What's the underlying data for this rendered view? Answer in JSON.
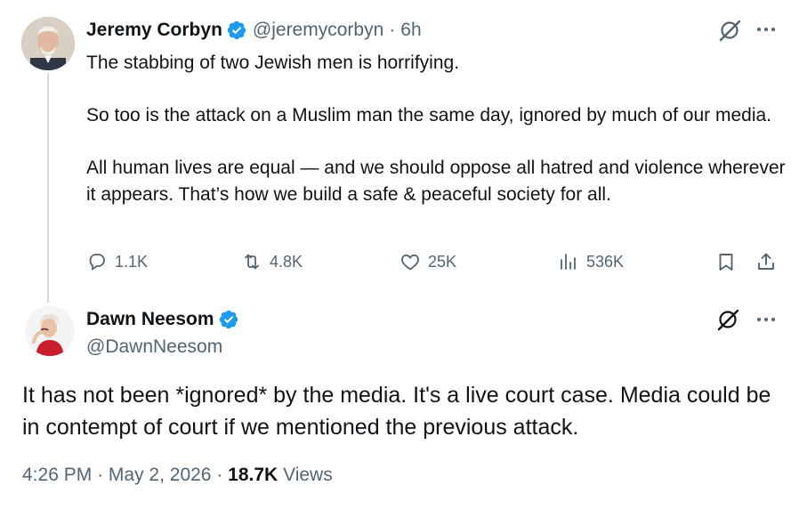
{
  "tweet": {
    "author": {
      "name": "Jeremy Corbyn",
      "handle": "@jeremycorbyn",
      "verified": true
    },
    "time_ago": "6h",
    "paragraphs": [
      "The stabbing of two Jewish men is horrifying.",
      "So too is the attack on a Muslim man the same day, ignored by much of our media.",
      "All human lives are equal — and we should oppose all hatred and violence wherever it appears. That’s how we build a safe & peaceful society for all."
    ],
    "stats": {
      "replies": "1.1K",
      "retweets": "4.8K",
      "likes": "25K",
      "views": "536K"
    }
  },
  "reply": {
    "author": {
      "name": "Dawn Neesom",
      "handle": "@DawnNeesom",
      "verified": true
    },
    "text": "It has not been *ignored* by the media. It's a live court case. Media could be in contempt of court if we mentioned the previous attack.",
    "time": "4:26 PM",
    "date": "May 2, 2026",
    "views_count": "18.7K",
    "views_label": "Views"
  },
  "separator": "·",
  "colors": {
    "verified": "#1d9bf0",
    "secondary_text": "#536471",
    "primary_text": "#0f1419",
    "thread_line": "#cfd9de"
  },
  "icons": [
    "verified-badge-icon",
    "grok-icon",
    "more-icon",
    "reply-icon",
    "retweet-icon",
    "like-icon",
    "views-icon",
    "bookmark-icon",
    "share-icon"
  ]
}
